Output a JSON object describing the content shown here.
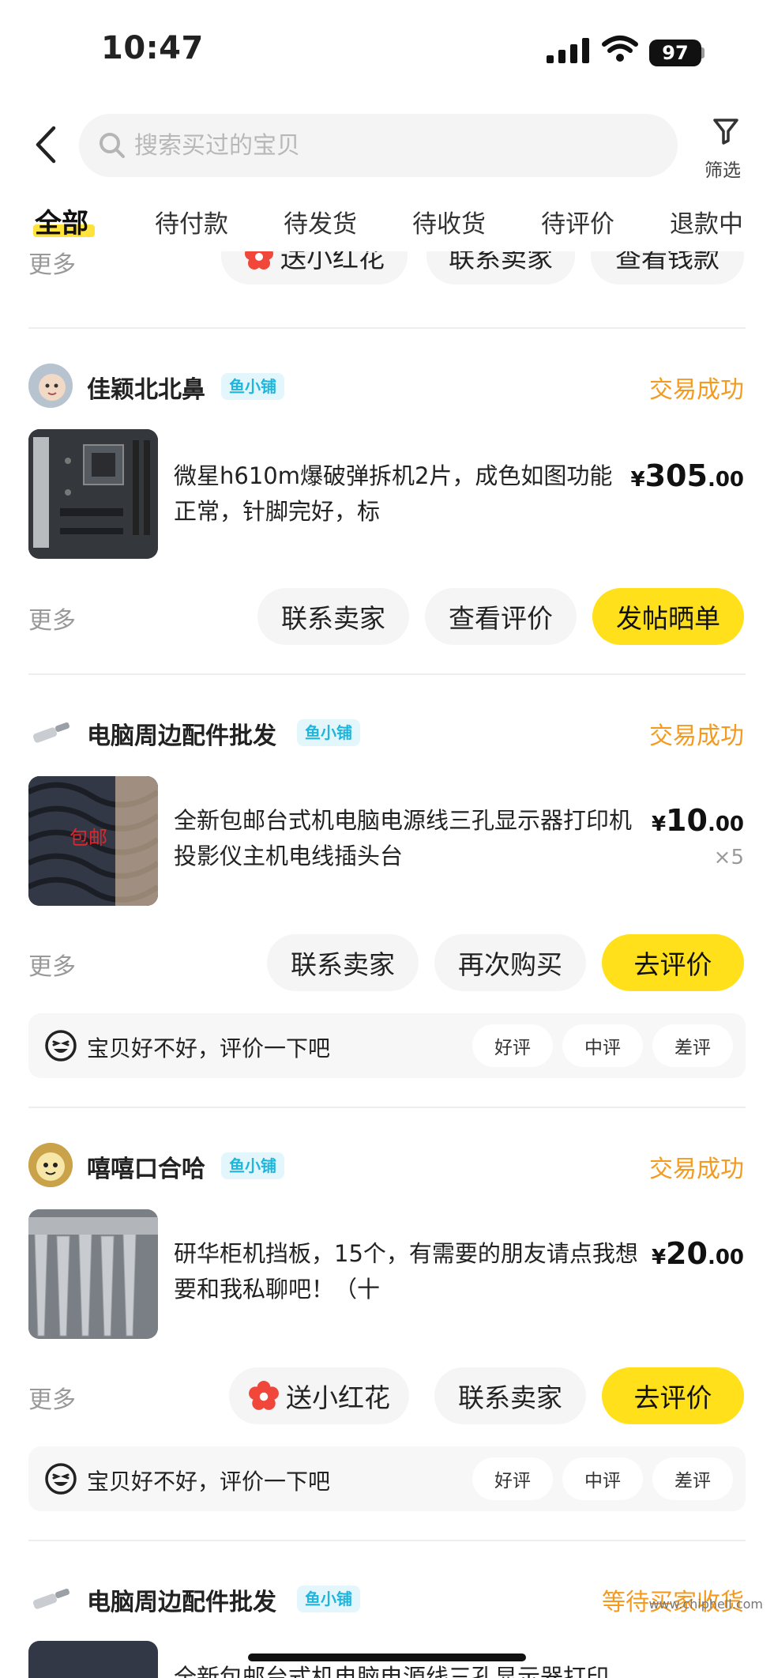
{
  "status_bar": {
    "time": "10:47",
    "battery": "97"
  },
  "header": {
    "search_placeholder": "搜索买过的宝贝",
    "filter_label": "筛选"
  },
  "tabs": [
    {
      "label": "全部"
    },
    {
      "label": "待付款"
    },
    {
      "label": "待发货"
    },
    {
      "label": "待收货"
    },
    {
      "label": "待评价"
    },
    {
      "label": "退款中"
    }
  ],
  "top_partial": {
    "more": "更多",
    "buttons": [
      "送小红花",
      "联系卖家",
      "查看钱款"
    ]
  },
  "orders": [
    {
      "shop": "佳颖北北鼻",
      "badge": "鱼小铺",
      "status": "交易成功",
      "title": "微星h610m爆破弹拆机2片，成色如图功能正常，针脚完好，标",
      "price_symbol": "¥",
      "price_int": "305",
      "price_dec": ".00",
      "more": "更多",
      "buttons": [
        "联系卖家",
        "查看评价",
        "发帖晒单"
      ]
    },
    {
      "shop": "电脑周边配件批发",
      "badge": "鱼小铺",
      "status": "交易成功",
      "title": "全新包邮台式机电脑电源线三孔显示器打印机投影仪主机电线插头台",
      "price_symbol": "¥",
      "price_int": "10",
      "price_dec": ".00",
      "qty": "×5",
      "thumb_text": "包邮",
      "more": "更多",
      "buttons": [
        "联系卖家",
        "再次购买",
        "去评价"
      ],
      "review_prompt": "宝贝好不好，评价一下吧",
      "review_options": [
        "好评",
        "中评",
        "差评"
      ]
    },
    {
      "shop": "嘻嘻口合哈",
      "badge": "鱼小铺",
      "status": "交易成功",
      "title": "研华柜机挡板，15个，有需要的朋友请点我想要和我私聊吧！（十",
      "price_symbol": "¥",
      "price_int": "20",
      "price_dec": ".00",
      "more": "更多",
      "buttons": [
        "送小红花",
        "联系卖家",
        "去评价"
      ],
      "review_prompt": "宝贝好不好，评价一下吧",
      "review_options": [
        "好评",
        "中评",
        "差评"
      ]
    },
    {
      "shop": "电脑周边配件批发",
      "badge": "鱼小铺",
      "status": "等待买家收货",
      "title": "全新包邮台式机电脑电源线三孔显示器打印"
    }
  ],
  "watermark": "www.chiphell.com",
  "colors": {
    "accent_yellow": "#ffe01a",
    "status_orange": "#f39a1f",
    "badge_blue": "#1fb6dd",
    "flower_red": "#f0473a"
  }
}
